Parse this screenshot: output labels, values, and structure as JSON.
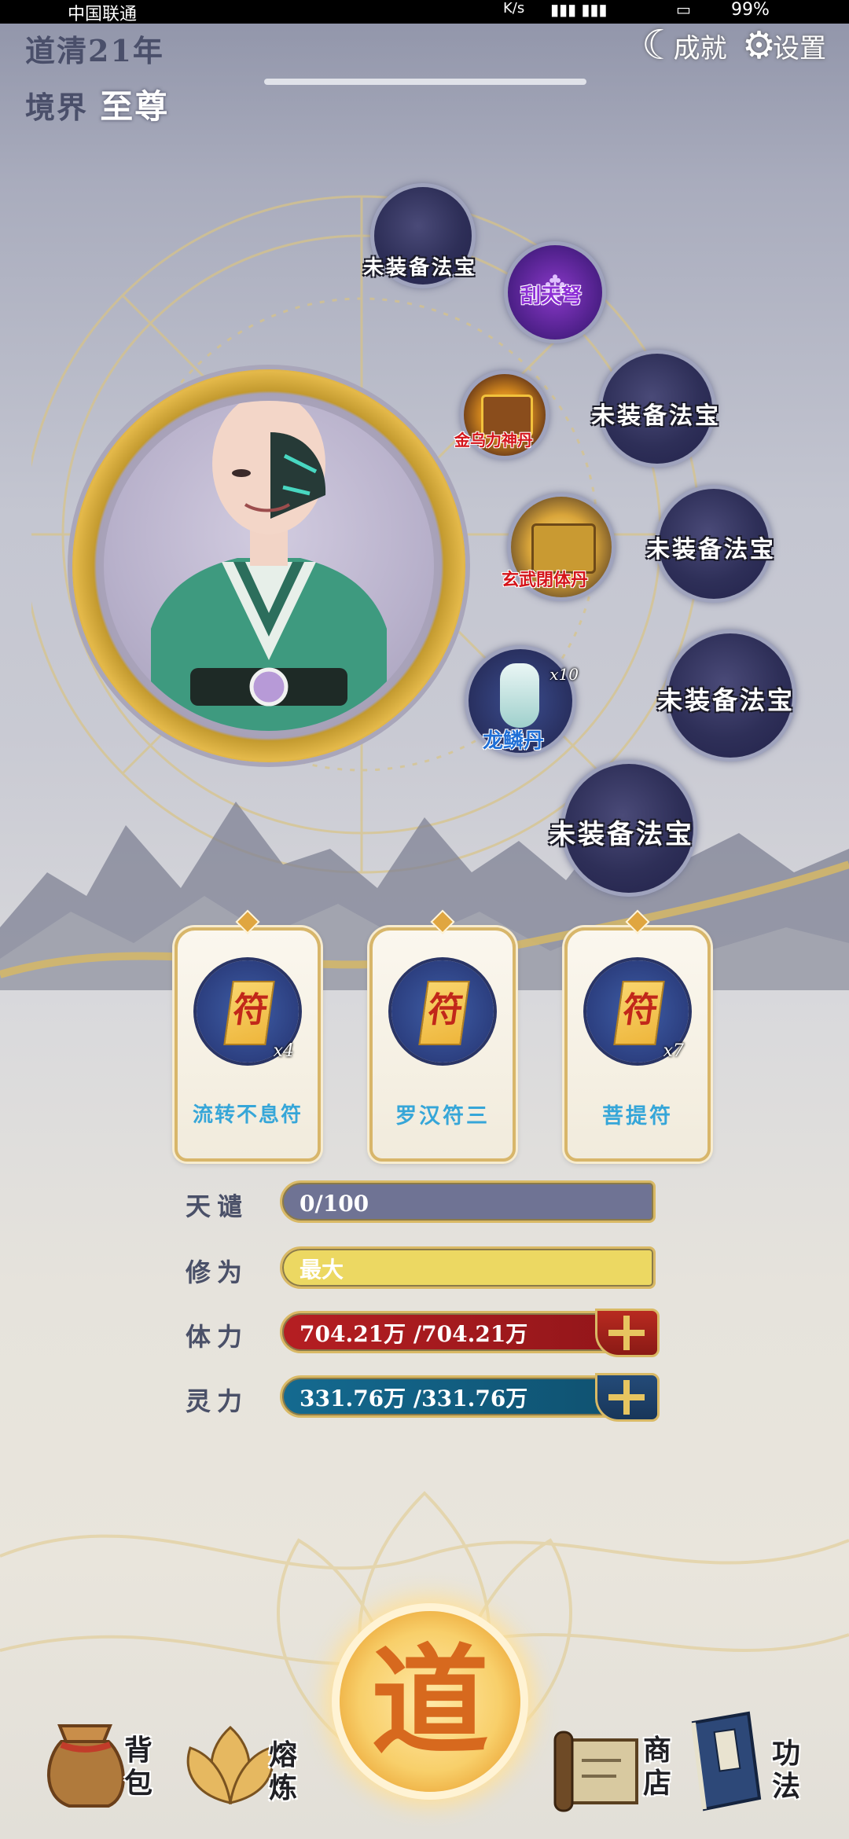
{
  "status_bar": {
    "carrier": "中国联通",
    "speed_unit": "K/s",
    "battery": "99%"
  },
  "header": {
    "dao_age": "道清21年",
    "realm_label": "境界",
    "realm_value": "至尊",
    "achievements_label": "成就",
    "settings_label": "设置"
  },
  "equipment": {
    "slots": [
      {
        "label": "未装备法宝"
      },
      {
        "label": "未装备法宝"
      },
      {
        "label": "未装备法宝"
      },
      {
        "label": "未装备法宝"
      },
      {
        "label": "未装备法宝"
      }
    ],
    "items": [
      {
        "name": "刮天弩",
        "color": "#8d2fd6"
      },
      {
        "name": "金乌力神丹",
        "color": "#d4141a"
      },
      {
        "name": "玄武閉体丹",
        "color": "#d4141a"
      },
      {
        "name": "龙鳞丹",
        "color": "#1f6fd6",
        "count": "x10"
      }
    ]
  },
  "talismans": [
    {
      "name": "流转不息符",
      "count": "x4",
      "glyph": "符"
    },
    {
      "name": "罗汉符三",
      "count": "",
      "glyph": "符"
    },
    {
      "name": "菩提符",
      "count": "x7",
      "glyph": "符"
    }
  ],
  "stats": {
    "tianqian": {
      "label": "天谴",
      "value": "0/100",
      "color": "#6f7394"
    },
    "xiuwei": {
      "label": "修为",
      "value": "最大",
      "color": "#ecd862"
    },
    "tili": {
      "label": "体力",
      "value": "704.21万 /704.21万",
      "color": "#a3181c"
    },
    "lingli": {
      "label": "灵力",
      "value": "331.76万 /331.76万",
      "color": "#10597a"
    }
  },
  "bottom_menu": {
    "backpack": "背包",
    "smelt": "熔炼",
    "dao": "道",
    "shop": "商店",
    "skills": "功法"
  }
}
